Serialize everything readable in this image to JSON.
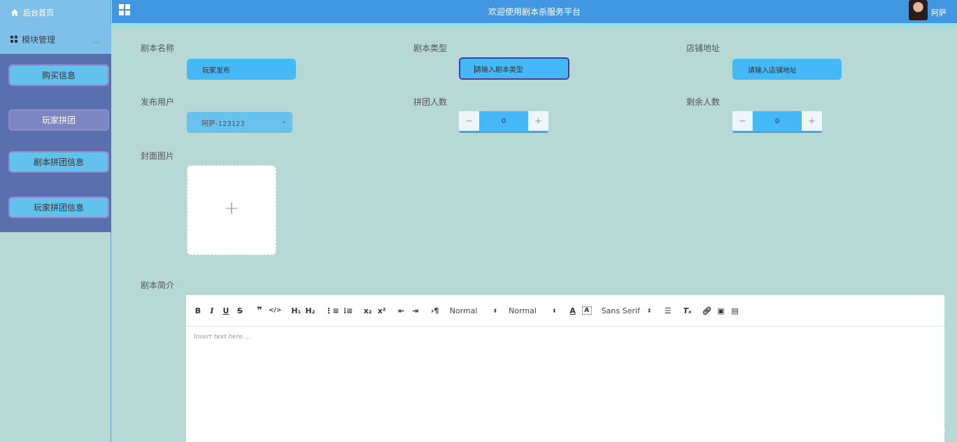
{
  "sidebar": {
    "home_label": "后台首页",
    "group_label": "模块管理",
    "items": [
      {
        "label": "购买信息"
      },
      {
        "label": "玩家拼团"
      },
      {
        "label": "剧本拼团信息"
      },
      {
        "label": "玩家拼团信息"
      }
    ]
  },
  "header": {
    "title": "欢迎使用剧本杀服务平台",
    "username": "阿萨"
  },
  "form": {
    "script_name": {
      "label": "剧本名称",
      "value": "玩家发布"
    },
    "script_type": {
      "label": "剧本类型",
      "placeholder": "请输入剧本类型"
    },
    "shop_address": {
      "label": "店铺地址",
      "placeholder": "请输入店铺地址"
    },
    "publisher": {
      "label": "发布用户",
      "value": "阿萨-123123"
    },
    "group_count": {
      "label": "拼团人数",
      "value": "0"
    },
    "remaining_count": {
      "label": "剩余人数",
      "value": "0"
    },
    "cover_image": {
      "label": "封面图片"
    },
    "description": {
      "label": "剧本简介",
      "placeholder": "Insert text here ..."
    }
  },
  "editor": {
    "header_picker": "Normal",
    "size_picker": "Normal",
    "font_picker": "Sans Serif"
  },
  "watermark": "CSDN @Q_6310855"
}
